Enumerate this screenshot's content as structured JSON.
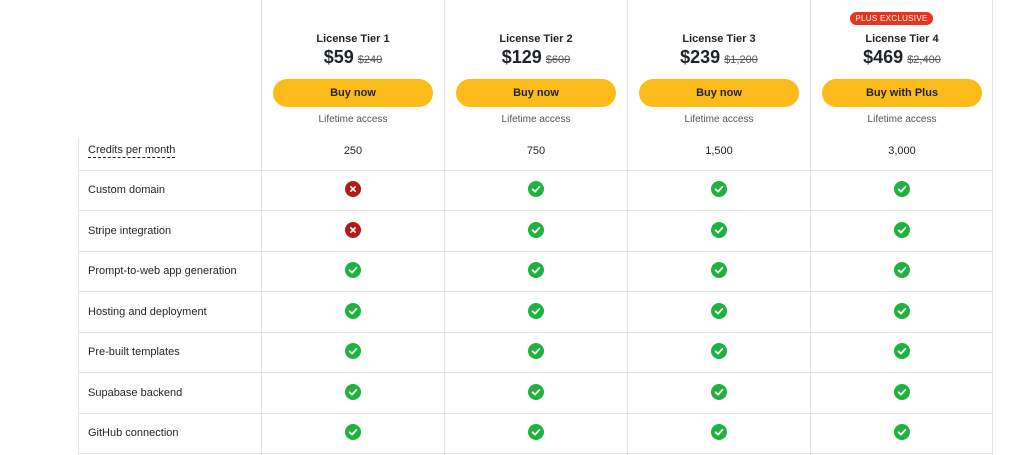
{
  "tiers": [
    {
      "name": "License Tier 1",
      "price": "$59",
      "old_price": "$240",
      "button": "Buy now",
      "note": "Lifetime access"
    },
    {
      "name": "License Tier 2",
      "price": "$129",
      "old_price": "$600",
      "button": "Buy now",
      "note": "Lifetime access"
    },
    {
      "name": "License Tier 3",
      "price": "$239",
      "old_price": "$1,200",
      "button": "Buy now",
      "note": "Lifetime access"
    },
    {
      "name": "License Tier 4",
      "price": "$469",
      "old_price": "$2,400",
      "button": "Buy with Plus",
      "note": "Lifetime access",
      "badge": "PLUS EXCLUSIVE"
    }
  ],
  "features": [
    {
      "label": "Credits per month",
      "values": [
        "250",
        "750",
        "1,500",
        "3,000"
      ]
    },
    {
      "label": "Custom domain",
      "values": [
        "cross",
        "check",
        "check",
        "check"
      ]
    },
    {
      "label": "Stripe integration",
      "values": [
        "cross",
        "check",
        "check",
        "check"
      ]
    },
    {
      "label": "Prompt-to-web app generation",
      "values": [
        "check",
        "check",
        "check",
        "check"
      ]
    },
    {
      "label": "Hosting and deployment",
      "values": [
        "check",
        "check",
        "check",
        "check"
      ]
    },
    {
      "label": "Pre-built templates",
      "values": [
        "check",
        "check",
        "check",
        "check"
      ]
    },
    {
      "label": "Supabase backend",
      "values": [
        "check",
        "check",
        "check",
        "check"
      ]
    },
    {
      "label": "GitHub connection",
      "values": [
        "check",
        "check",
        "check",
        "check"
      ]
    }
  ],
  "icons": {
    "check": "check-circle-icon",
    "cross": "cross-circle-icon"
  },
  "colors": {
    "button": "#fdbb1a",
    "badge": "#e8341c",
    "check": "#1db33d",
    "cross": "#b31b1b"
  }
}
